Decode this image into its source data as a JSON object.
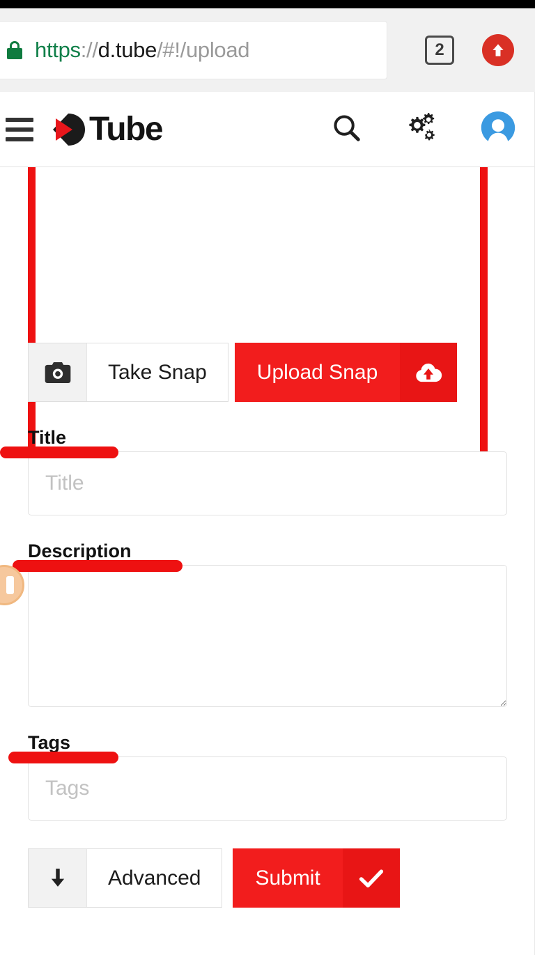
{
  "browser": {
    "url": {
      "scheme": "https",
      "separator": "://",
      "host": "d.tube",
      "path": "/#!/upload",
      "full": "https://d.tube/#!/upload"
    },
    "lock_icon": "lock-icon",
    "tab_count": "2",
    "upload_badge_icon": "arrow-up-circle-icon"
  },
  "site_header": {
    "menu_icon": "hamburger-menu-icon",
    "logo_text": "Tube",
    "logo_mark_icon": "dtube-play-d-icon",
    "actions": [
      {
        "name": "search-icon",
        "label": "Search"
      },
      {
        "name": "gears-icon",
        "label": "Settings"
      },
      {
        "name": "avatar-icon",
        "label": "Account"
      }
    ]
  },
  "form": {
    "snap_buttons": {
      "take_snap": {
        "label": "Take Snap",
        "icon": "camera-icon"
      },
      "upload_snap": {
        "label": "Upload Snap",
        "icon": "cloud-upload-icon"
      }
    },
    "title": {
      "label": "Title",
      "placeholder": "Title",
      "value": ""
    },
    "description": {
      "label": "Description",
      "placeholder": "",
      "value": ""
    },
    "tags": {
      "label": "Tags",
      "placeholder": "Tags",
      "value": ""
    },
    "advanced_button": {
      "label": "Advanced",
      "icon": "arrow-down-icon"
    },
    "submit_button": {
      "label": "Submit",
      "icon": "check-icon"
    }
  },
  "annotations": {
    "box_color": "#ee1111",
    "underline_color": "#ee1111"
  },
  "colors": {
    "brand_red": "#f21d1d",
    "accent_blue": "#3b9ae1",
    "lock_green": "#0f7b3f",
    "chrome_gray": "#f1f1f1"
  },
  "side_handle": {
    "name": "side-panel-handle",
    "icon": "panel-toggle-icon"
  }
}
